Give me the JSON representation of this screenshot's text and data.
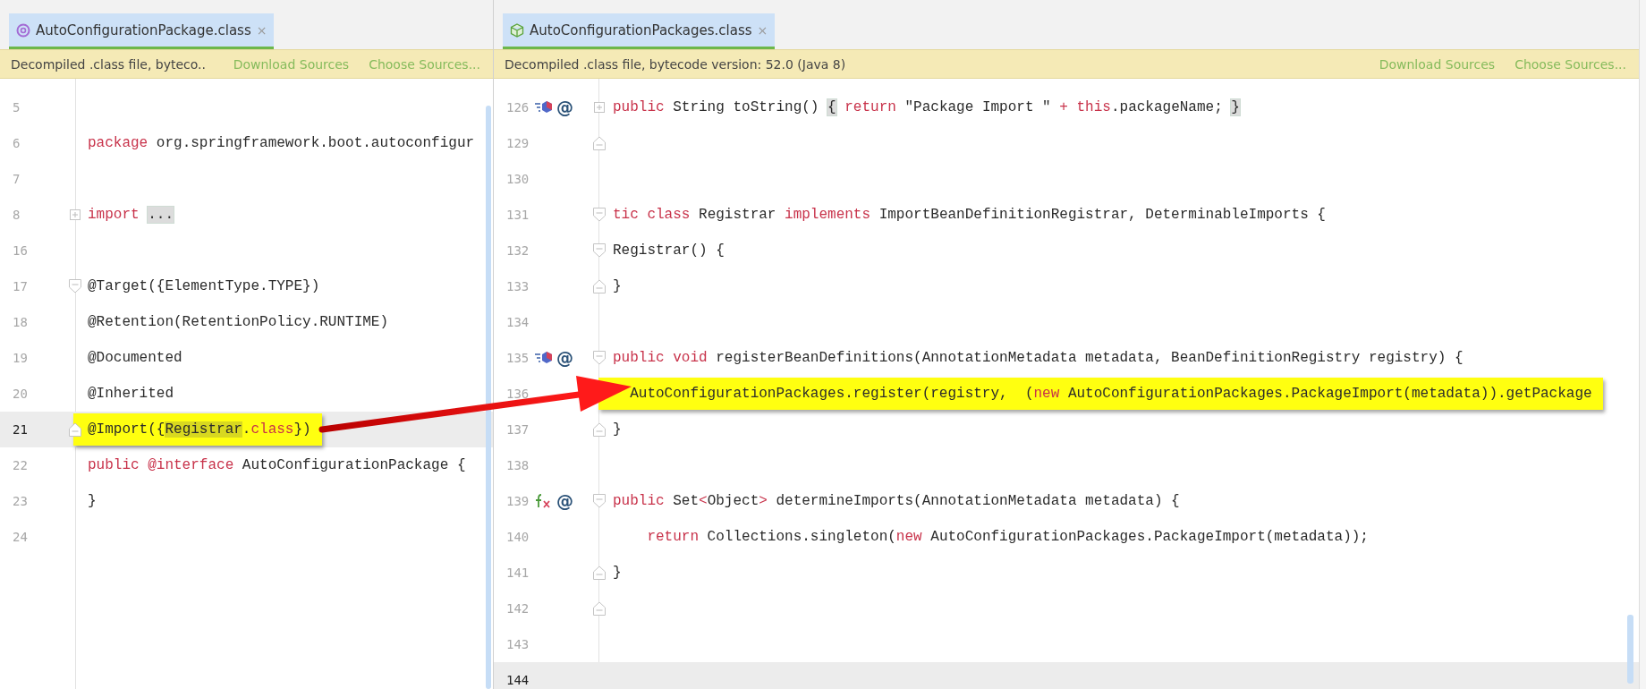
{
  "panes": [
    {
      "tab": {
        "title": "AutoConfigurationPackage.class",
        "kind": "annotation",
        "selected": true,
        "close": "×"
      },
      "banner": {
        "message": "Decompiled .class file, byteco..",
        "links": [
          "Download Sources",
          "Choose Sources..."
        ]
      },
      "lines": [
        {
          "number": "5",
          "current": false
        },
        {
          "number": "6",
          "current": false,
          "segments": [
            {
              "kind": "keyword",
              "text": "package"
            },
            {
              "kind": "plain",
              "text": " org.springframework.boot.autoconfigur"
            }
          ]
        },
        {
          "number": "7",
          "current": false
        },
        {
          "number": "8",
          "current": false,
          "fold": {
            "kind": "expand"
          },
          "segments": [
            {
              "kind": "keyword",
              "text": "import "
            },
            {
              "kind": "folded",
              "text": "..."
            }
          ]
        },
        {
          "number": "16",
          "current": false
        },
        {
          "number": "17",
          "current": false,
          "fold": {
            "kind": "start"
          },
          "segments": [
            {
              "kind": "plain",
              "text": "@Target({ElementType.TYPE})"
            }
          ]
        },
        {
          "number": "18",
          "current": false,
          "segments": [
            {
              "kind": "plain",
              "text": "@Retention(RetentionPolicy.RUNTIME)"
            }
          ]
        },
        {
          "number": "19",
          "current": false,
          "segments": [
            {
              "kind": "plain",
              "text": "@Documented"
            }
          ]
        },
        {
          "number": "20",
          "current": false,
          "segments": [
            {
              "kind": "plain",
              "text": "@Inherited"
            }
          ]
        },
        {
          "number": "21",
          "current": true,
          "highlighted": true,
          "fold": {
            "kind": "end"
          },
          "segments": [
            {
              "kind": "plain",
              "text": "@Import({"
            },
            {
              "kind": "usage",
              "text": "Registrar"
            },
            {
              "kind": "plain",
              "text": "."
            },
            {
              "kind": "keyword",
              "text": "class"
            },
            {
              "kind": "plain",
              "text": "})"
            }
          ]
        },
        {
          "number": "22",
          "current": false,
          "segments": [
            {
              "kind": "keyword",
              "text": "public @interface"
            },
            {
              "kind": "plain",
              "text": " AutoConfigurationPackage {"
            }
          ]
        },
        {
          "number": "23",
          "current": false,
          "segments": [
            {
              "kind": "plain",
              "text": "}"
            }
          ]
        },
        {
          "number": "24",
          "current": false
        }
      ]
    },
    {
      "tab": {
        "title": "AutoConfigurationPackages.class",
        "kind": "class",
        "selected": true,
        "close": "×"
      },
      "banner": {
        "message": "Decompiled .class file, bytecode version: 52.0 (Java 8)",
        "links": [
          "Download Sources",
          "Choose Sources..."
        ]
      },
      "lines": [
        {
          "number": "126",
          "current": false,
          "fold": {
            "kind": "expand"
          },
          "gutter": {
            "kind": "implements",
            "mark": "@"
          },
          "segments": [
            {
              "kind": "keyword",
              "text": "public"
            },
            {
              "kind": "plain",
              "text": " String toString() "
            },
            {
              "kind": "folded",
              "text": "{"
            },
            {
              "kind": "keyword",
              "text": " return"
            },
            {
              "kind": "plain",
              "text": " \"Package Import \" "
            },
            {
              "kind": "keyword",
              "text": "+ this"
            },
            {
              "kind": "plain",
              "text": ".packageName; "
            },
            {
              "kind": "folded",
              "text": "}"
            }
          ]
        },
        {
          "number": "129",
          "current": false,
          "fold": {
            "kind": "end"
          }
        },
        {
          "number": "130",
          "current": false
        },
        {
          "number": "131",
          "current": false,
          "fold": {
            "kind": "start"
          },
          "segments": [
            {
              "kind": "keyword",
              "text": "tic class"
            },
            {
              "kind": "plain",
              "text": " Registrar "
            },
            {
              "kind": "keyword",
              "text": "implements"
            },
            {
              "kind": "plain",
              "text": " ImportBeanDefinitionRegistrar, DeterminableImports {"
            }
          ]
        },
        {
          "number": "132",
          "current": false,
          "fold": {
            "kind": "start"
          },
          "segments": [
            {
              "kind": "plain",
              "text": "Registrar() {"
            }
          ]
        },
        {
          "number": "133",
          "current": false,
          "fold": {
            "kind": "end"
          },
          "segments": [
            {
              "kind": "plain",
              "text": "}"
            }
          ]
        },
        {
          "number": "134",
          "current": false
        },
        {
          "number": "135",
          "current": false,
          "fold": {
            "kind": "start"
          },
          "gutter": {
            "kind": "implements",
            "mark": "@"
          },
          "segments": [
            {
              "kind": "keyword",
              "text": "public void"
            },
            {
              "kind": "plain",
              "text": " registerBeanDefinitions(AnnotationMetadata metadata, BeanDefinitionRegistry registry) {"
            }
          ]
        },
        {
          "number": "136",
          "current": false,
          "highlighted": true,
          "segments": [
            {
              "kind": "plain",
              "text": "  AutoConfigurationPackages.register(registry,  ("
            },
            {
              "kind": "keyword",
              "text": "new"
            },
            {
              "kind": "plain",
              "text": " AutoConfigurationPackages.PackageImport(metadata)).getPackage"
            }
          ]
        },
        {
          "number": "137",
          "current": false,
          "fold": {
            "kind": "end"
          },
          "segments": [
            {
              "kind": "plain",
              "text": "}"
            }
          ]
        },
        {
          "number": "138",
          "current": false
        },
        {
          "number": "139",
          "current": false,
          "fold": {
            "kind": "start"
          },
          "gutter": {
            "kind": "function",
            "mark": "@"
          },
          "segments": [
            {
              "kind": "keyword",
              "text": "public"
            },
            {
              "kind": "plain",
              "text": " Set"
            },
            {
              "kind": "keyword",
              "text": "<"
            },
            {
              "kind": "plain",
              "text": "Object"
            },
            {
              "kind": "keyword",
              "text": ">"
            },
            {
              "kind": "plain",
              "text": " determineImports(AnnotationMetadata metadata) {"
            }
          ]
        },
        {
          "number": "140",
          "current": false,
          "segments": [
            {
              "kind": "keyword",
              "text": "    return"
            },
            {
              "kind": "plain",
              "text": " Collections.singleton("
            },
            {
              "kind": "keyword",
              "text": "new"
            },
            {
              "kind": "plain",
              "text": " AutoConfigurationPackages.PackageImport(metadata));"
            }
          ]
        },
        {
          "number": "141",
          "current": false,
          "fold": {
            "kind": "end"
          },
          "segments": [
            {
              "kind": "plain",
              "text": "}"
            }
          ]
        },
        {
          "number": "142",
          "current": false,
          "fold": {
            "kind": "end"
          }
        },
        {
          "number": "143",
          "current": false
        },
        {
          "number": "144",
          "current": true
        }
      ]
    }
  ]
}
